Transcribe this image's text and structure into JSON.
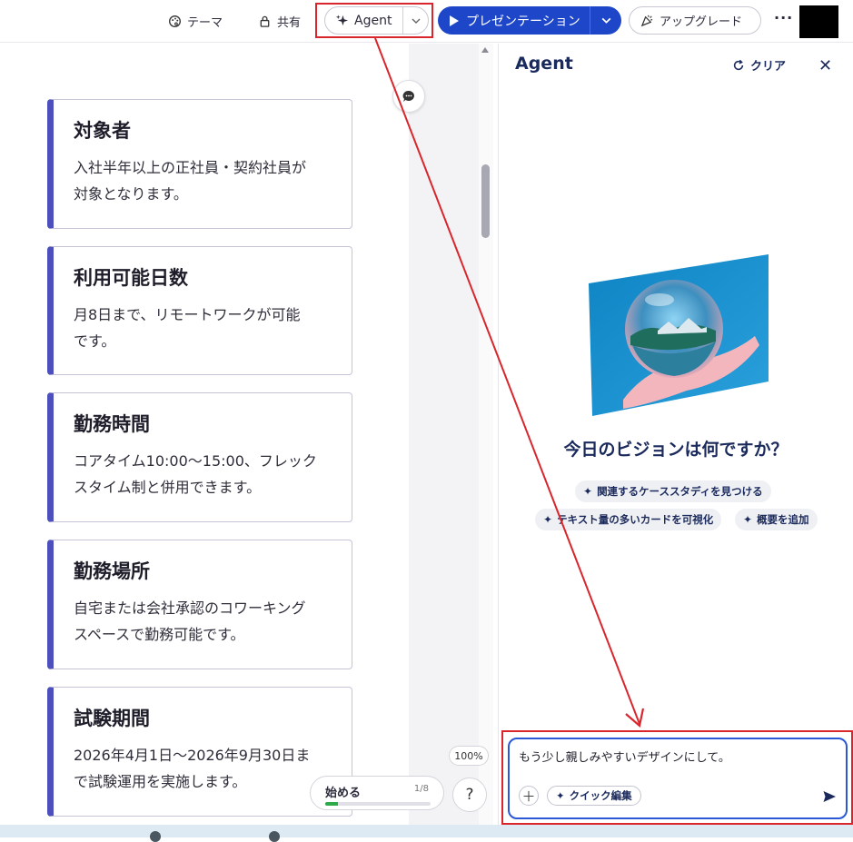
{
  "toolbar": {
    "theme_label": "テーマ",
    "share_label": "共有",
    "agent_label": "Agent",
    "present_label": "プレゼンテーション",
    "upgrade_label": "アップグレード",
    "more_label": "···"
  },
  "cards": [
    {
      "title": "対象者",
      "body_lines": [
        "入社半年以上の正社員・契約社員が",
        "対象となります。"
      ]
    },
    {
      "title": "利用可能日数",
      "body_lines": [
        "月8日まで、リモートワークが可能",
        "です。"
      ]
    },
    {
      "title": "勤務時間",
      "body_lines": [
        "コアタイム10:00〜15:00、フレック",
        "スタイム制と併用できます。"
      ]
    },
    {
      "title": "勤務場所",
      "body_lines": [
        "自宅または会社承認のコワーキング",
        "スペースで勤務可能です。"
      ]
    },
    {
      "title": "試験期間",
      "body_lines": [
        "2026年4月1日〜2026年9月30日ま",
        "で試験運用を実施します。"
      ]
    }
  ],
  "canvas": {
    "zoom": "100%",
    "start_label": "始める",
    "start_count": "1/8",
    "start_progress": 0.12,
    "help_label": "?"
  },
  "agent_panel": {
    "title": "Agent",
    "clear_label": "クリア",
    "close_label": "✕",
    "heading": "今日のビジョンは何ですか？",
    "suggestions": [
      "関連するケーススタディを見つける",
      "テキスト量の多いカードを可視化",
      "概要を追加"
    ],
    "input_value": "もう少し親しみやすいデザインにして。",
    "plus_label": "＋",
    "quick_edit_label": "クイック編集"
  },
  "colors": {
    "accent_blue": "#1d46c8",
    "card_border_left": "#4d4fbd",
    "annotation_red": "#d9262c",
    "navy_text": "#1b2a5c"
  },
  "icons": {
    "theme": "palette-icon",
    "share": "lock-icon",
    "agent": "sparkle-icon",
    "present": "play-icon",
    "upgrade": "party-popper-icon",
    "clear": "refresh-icon",
    "send": "send-icon"
  }
}
